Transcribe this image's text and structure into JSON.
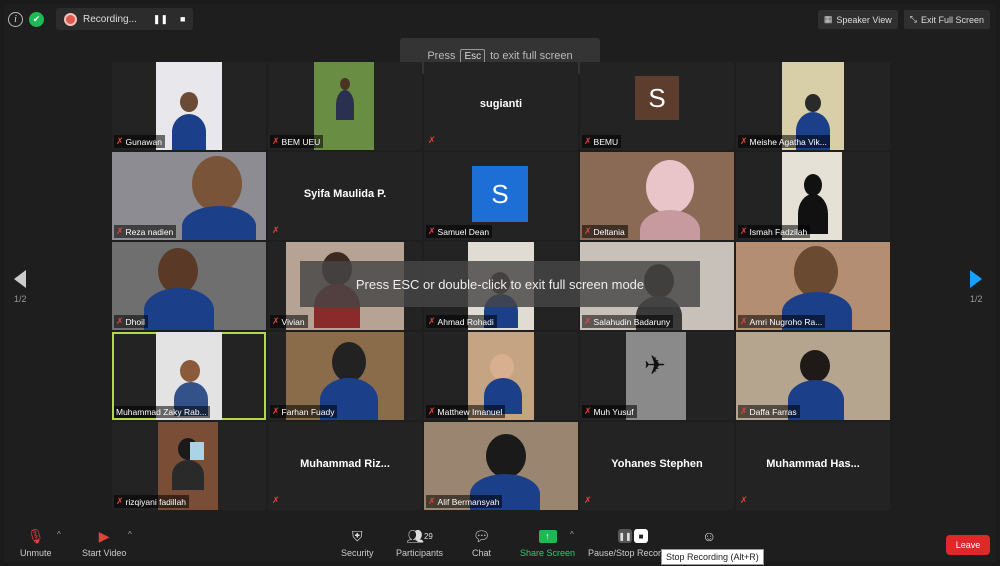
{
  "recording": {
    "label": "Recording...",
    "pause_icon": "pause-icon",
    "stop_icon": "stop-icon"
  },
  "top_right": {
    "speaker_view": "Speaker View",
    "exit_full_screen": "Exit Full Screen"
  },
  "esc_hint": {
    "before": "Press",
    "key": "Esc",
    "after": "to exit full screen"
  },
  "overlay_message": "Press ESC or double-click to exit full screen mode",
  "page_indicator": {
    "left": "1/2",
    "right": "1/2"
  },
  "participants": [
    {
      "name": "Gunawan"
    },
    {
      "name": "BEM UEU"
    },
    {
      "name": "sugianti"
    },
    {
      "name": "BEMU",
      "avatar": "S"
    },
    {
      "name": "Meishe Agatha Vik..."
    },
    {
      "name": "Reza nadien"
    },
    {
      "name": "Syifa Maulida P."
    },
    {
      "name": "Samuel Dean",
      "avatar": "S"
    },
    {
      "name": "Deltania"
    },
    {
      "name": "Ismah Fadzilah"
    },
    {
      "name": "Dhoil"
    },
    {
      "name": "Vivian"
    },
    {
      "name": "Ahmad Rohadi"
    },
    {
      "name": "Salahudin Badaruny"
    },
    {
      "name": "Amri Nugroho Ra..."
    },
    {
      "name": "Muhammad Zaky Rab..."
    },
    {
      "name": "Farhan Fuady"
    },
    {
      "name": "Matthew Imanuel"
    },
    {
      "name": "Muh Yusuf"
    },
    {
      "name": "Daffa Farras"
    },
    {
      "name": "rizqiyani fadillah"
    },
    {
      "name": "Muhammad  Riz..."
    },
    {
      "name": "Alif Bermansyah"
    },
    {
      "name": "Yohanes Stephen"
    },
    {
      "name": "Muhammad  Has..."
    }
  ],
  "toolbar": {
    "unmute": "Unmute",
    "start_video": "Start Video",
    "security": "Security",
    "participants": "Participants",
    "participants_count": "29",
    "chat": "Chat",
    "share_screen": "Share Screen",
    "pause_stop_recording": "Pause/Stop Recording",
    "leave": "Leave"
  },
  "tooltip": "Stop Recording (Alt+R)",
  "colors": {
    "leave": "#e02828",
    "share": "#1db954",
    "active_speaker": "#b5d84a",
    "mic_muted": "#e0433a"
  }
}
